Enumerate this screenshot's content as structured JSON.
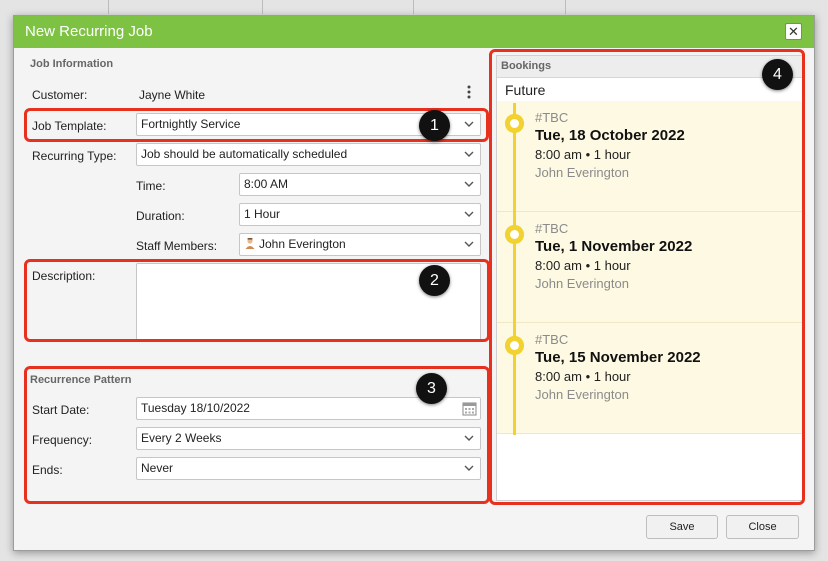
{
  "dialog": {
    "title": "New Recurring Job",
    "close_glyph": "✕"
  },
  "job_information": {
    "section_title": "Job Information",
    "customer_label": "Customer:",
    "customer_value": "Jayne White",
    "job_template_label": "Job Template:",
    "job_template_value": "Fortnightly Service",
    "recurring_type_label": "Recurring Type:",
    "recurring_type_value": "Job should be automatically scheduled",
    "time_label": "Time:",
    "time_value": "8:00 AM",
    "duration_label": "Duration:",
    "duration_value": "1 Hour",
    "staff_label": "Staff Members:",
    "staff_value": "John Everington",
    "description_label": "Description:",
    "description_value": ""
  },
  "recurrence_pattern": {
    "section_title": "Recurrence Pattern",
    "start_date_label": "Start Date:",
    "start_date_value": "Tuesday 18/10/2022",
    "frequency_label": "Frequency:",
    "frequency_value": "Every 2 Weeks",
    "ends_label": "Ends:",
    "ends_value": "Never"
  },
  "bookings": {
    "title": "Bookings",
    "group_label": "Future",
    "items": [
      {
        "tag": "#TBC",
        "date": "Tue, 18 October 2022",
        "time": "8:00 am • 1 hour",
        "staff": "John Everington"
      },
      {
        "tag": "#TBC",
        "date": "Tue, 1 November 2022",
        "time": "8:00 am • 1 hour",
        "staff": "John Everington"
      },
      {
        "tag": "#TBC",
        "date": "Tue, 15 November 2022",
        "time": "8:00 am • 1 hour",
        "staff": "John Everington"
      }
    ]
  },
  "callouts": [
    "1",
    "2",
    "3",
    "4"
  ],
  "footer": {
    "save_label": "Save",
    "close_label": "Close"
  },
  "colors": {
    "titlebar": "#7dc243",
    "highlight": "#e8301f",
    "timeline": "#f2d230",
    "booking_bg": "#fdf9e2"
  },
  "icons": {
    "close": "close-icon",
    "more": "kebab-menu-icon",
    "dropdown": "chevron-down-icon",
    "calendar": "calendar-icon",
    "staff": "person-icon"
  }
}
